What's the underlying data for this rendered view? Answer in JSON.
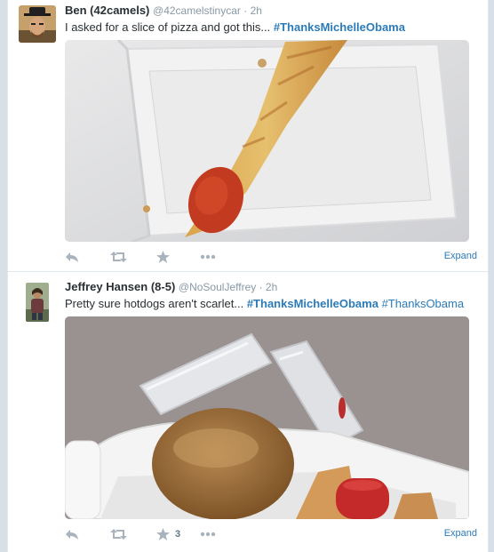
{
  "tweets": [
    {
      "fullname": "Ben (42camels)",
      "username": "@42camelstinycar",
      "time": "2h",
      "text": "I asked for a slice of pizza and got this...",
      "hashtags": [
        "#ThanksMichelleObama"
      ],
      "favorite_count": "",
      "expand_label": "Expand"
    },
    {
      "fullname": "Jeffrey Hansen (8-5)",
      "username": "@NoSoulJeffrey",
      "time": "2h",
      "text": "Pretty sure hotdogs aren't scarlet...",
      "hashtags": [
        "#ThanksMichelleObama",
        "#ThanksObama"
      ],
      "favorite_count": "3",
      "expand_label": "Expand"
    }
  ],
  "icons": {
    "reply": "reply-icon",
    "retweet": "retweet-icon",
    "favorite": "star-icon",
    "more": "more-dots-icon"
  },
  "colors": {
    "link": "#2b7bb9",
    "muted": "#8899a6",
    "icon": "#a8b3bd"
  }
}
